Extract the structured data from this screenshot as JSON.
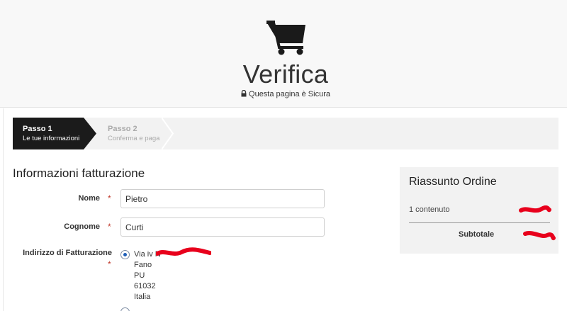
{
  "header": {
    "icon": "cart-icon",
    "title": "Verifica",
    "secure_icon": "lock-icon",
    "secure_text": "Questa pagina è Sicura"
  },
  "steps": [
    {
      "title": "Passo 1",
      "subtitle": "Le tue informazioni",
      "active": true
    },
    {
      "title": "Passo 2",
      "subtitle": "Conferma e paga",
      "active": false
    }
  ],
  "billing": {
    "section_title": "Informazioni fatturazione",
    "required_mark": "*",
    "nome_label": "Nome",
    "nome_value": "Pietro",
    "cognome_label": "Cognome",
    "cognome_value": "Curti",
    "address_label": "Indirizzo di Fatturazione",
    "address_lines": [
      "Via iv N",
      "Fano",
      "PU",
      "61032",
      "Italia"
    ]
  },
  "summary": {
    "title": "Riassunto Ordine",
    "count_text": "1 contenuto",
    "subtotal_label": "Subtotale"
  },
  "colors": {
    "step_active_bg": "#1b1b1b",
    "required": "#c0392b",
    "redaction": "#e8001c",
    "radio_selected": "#1f5fb8"
  }
}
